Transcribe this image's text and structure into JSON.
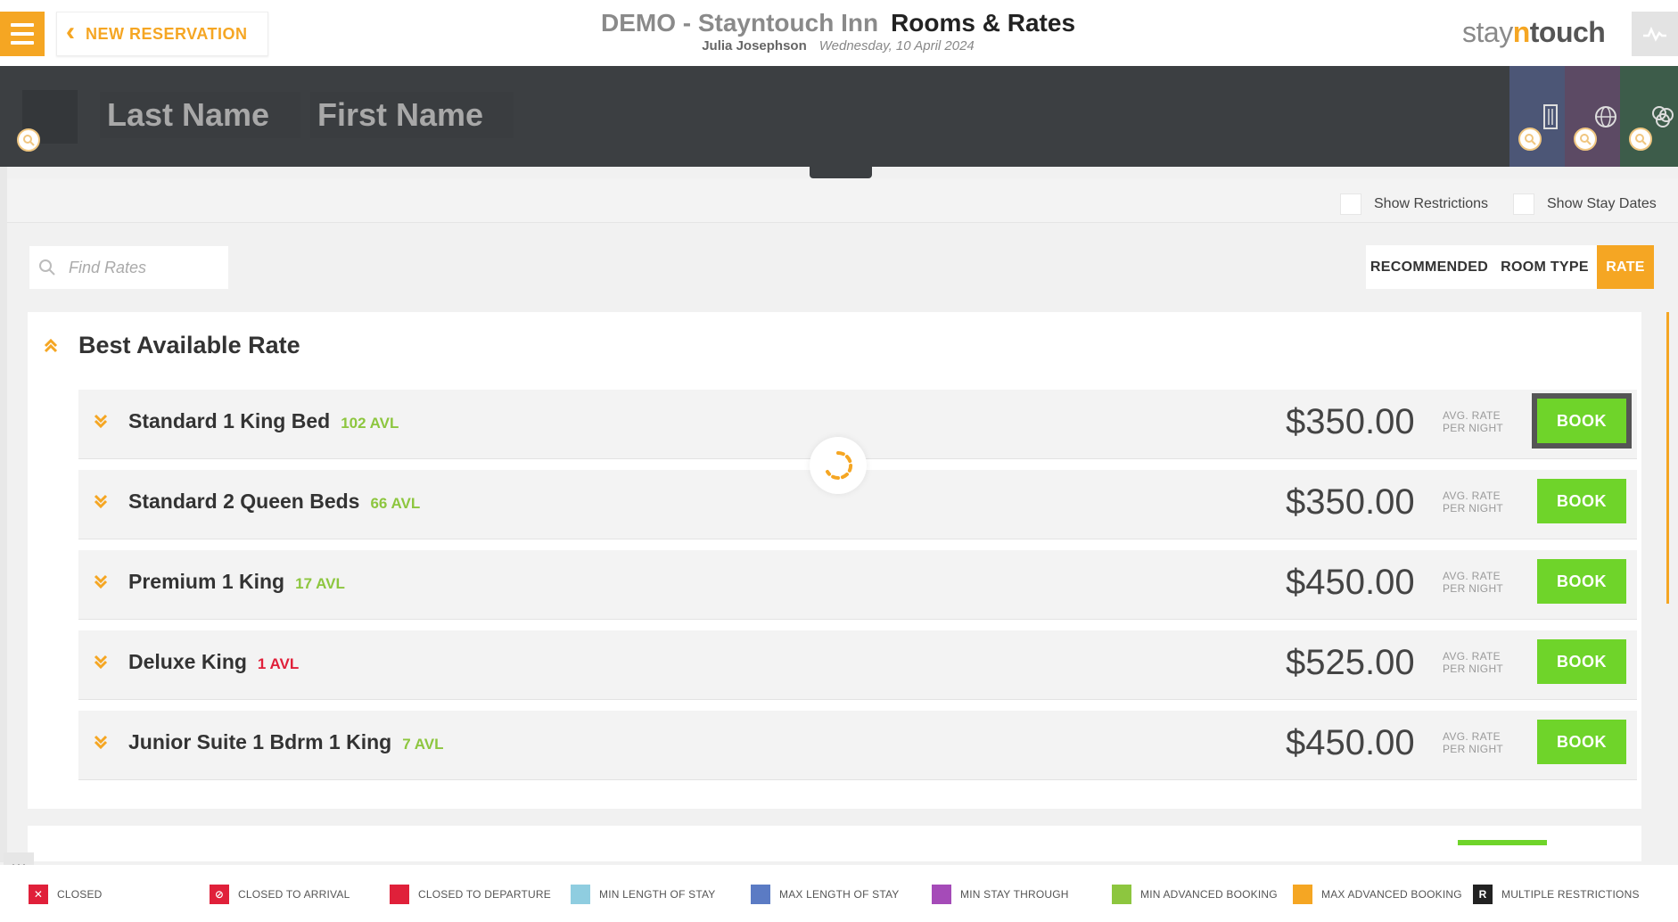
{
  "header": {
    "back_label": "NEW RESERVATION",
    "hotel_name": "DEMO - Stayntouch Inn",
    "page_title": "Rooms & Rates",
    "user_name": "Julia Josephson",
    "date": "Wednesday, 10 April 2024",
    "brand": {
      "part1": "stay",
      "part2": "n",
      "part3": "touch"
    }
  },
  "guest_search": {
    "last_name_placeholder": "Last Name",
    "first_name_placeholder": "First Name"
  },
  "options": {
    "show_restrictions": "Show Restrictions",
    "show_stay_dates": "Show Stay Dates"
  },
  "search": {
    "placeholder": "Find Rates"
  },
  "filters": [
    {
      "label": "RECOMMENDED",
      "active": false
    },
    {
      "label": "ROOM TYPE",
      "active": false
    },
    {
      "label": "RATE",
      "active": true
    }
  ],
  "rate_group": {
    "title": "Best Available Rate",
    "rate_label_1": "AVG. RATE",
    "rate_label_2": "PER NIGHT",
    "book_label": "BOOK",
    "rooms": [
      {
        "name": "Standard 1 King Bed",
        "avl": "102 AVL",
        "price": "$350.00"
      },
      {
        "name": "Standard 2 Queen Beds",
        "avl": "66 AVL",
        "price": "$350.00"
      },
      {
        "name": "Premium 1 King",
        "avl": "17 AVL",
        "price": "$450.00"
      },
      {
        "name": "Deluxe King",
        "avl": "1 AVL",
        "price": "$525.00"
      },
      {
        "name": "Junior Suite 1 Bdrm 1 King",
        "avl": "7 AVL",
        "price": "$450.00"
      }
    ]
  },
  "legend": [
    {
      "label": "CLOSED",
      "color": "#e0203a",
      "glyph": "✕"
    },
    {
      "label": "CLOSED TO ARRIVAL",
      "color": "#e0203a",
      "glyph": "⊘"
    },
    {
      "label": "CLOSED TO DEPARTURE",
      "color": "#e0203a",
      "glyph": ""
    },
    {
      "label": "MIN LENGTH OF STAY",
      "color": "#8fcde0",
      "glyph": ""
    },
    {
      "label": "MAX LENGTH OF STAY",
      "color": "#5b7bc4",
      "glyph": ""
    },
    {
      "label": "MIN STAY THROUGH",
      "color": "#a54bb8",
      "glyph": ""
    },
    {
      "label": "MIN ADVANCED BOOKING",
      "color": "#8dc63f",
      "glyph": ""
    },
    {
      "label": "MAX ADVANCED BOOKING",
      "color": "#f5a623",
      "glyph": ""
    },
    {
      "label": "MULTIPLE RESTRICTIONS",
      "color": "#222222",
      "glyph": "R"
    }
  ],
  "colors": {
    "accent": "#f5a623",
    "book": "#6fd42a",
    "available": "#8dc63f",
    "low": "#e0203a"
  }
}
